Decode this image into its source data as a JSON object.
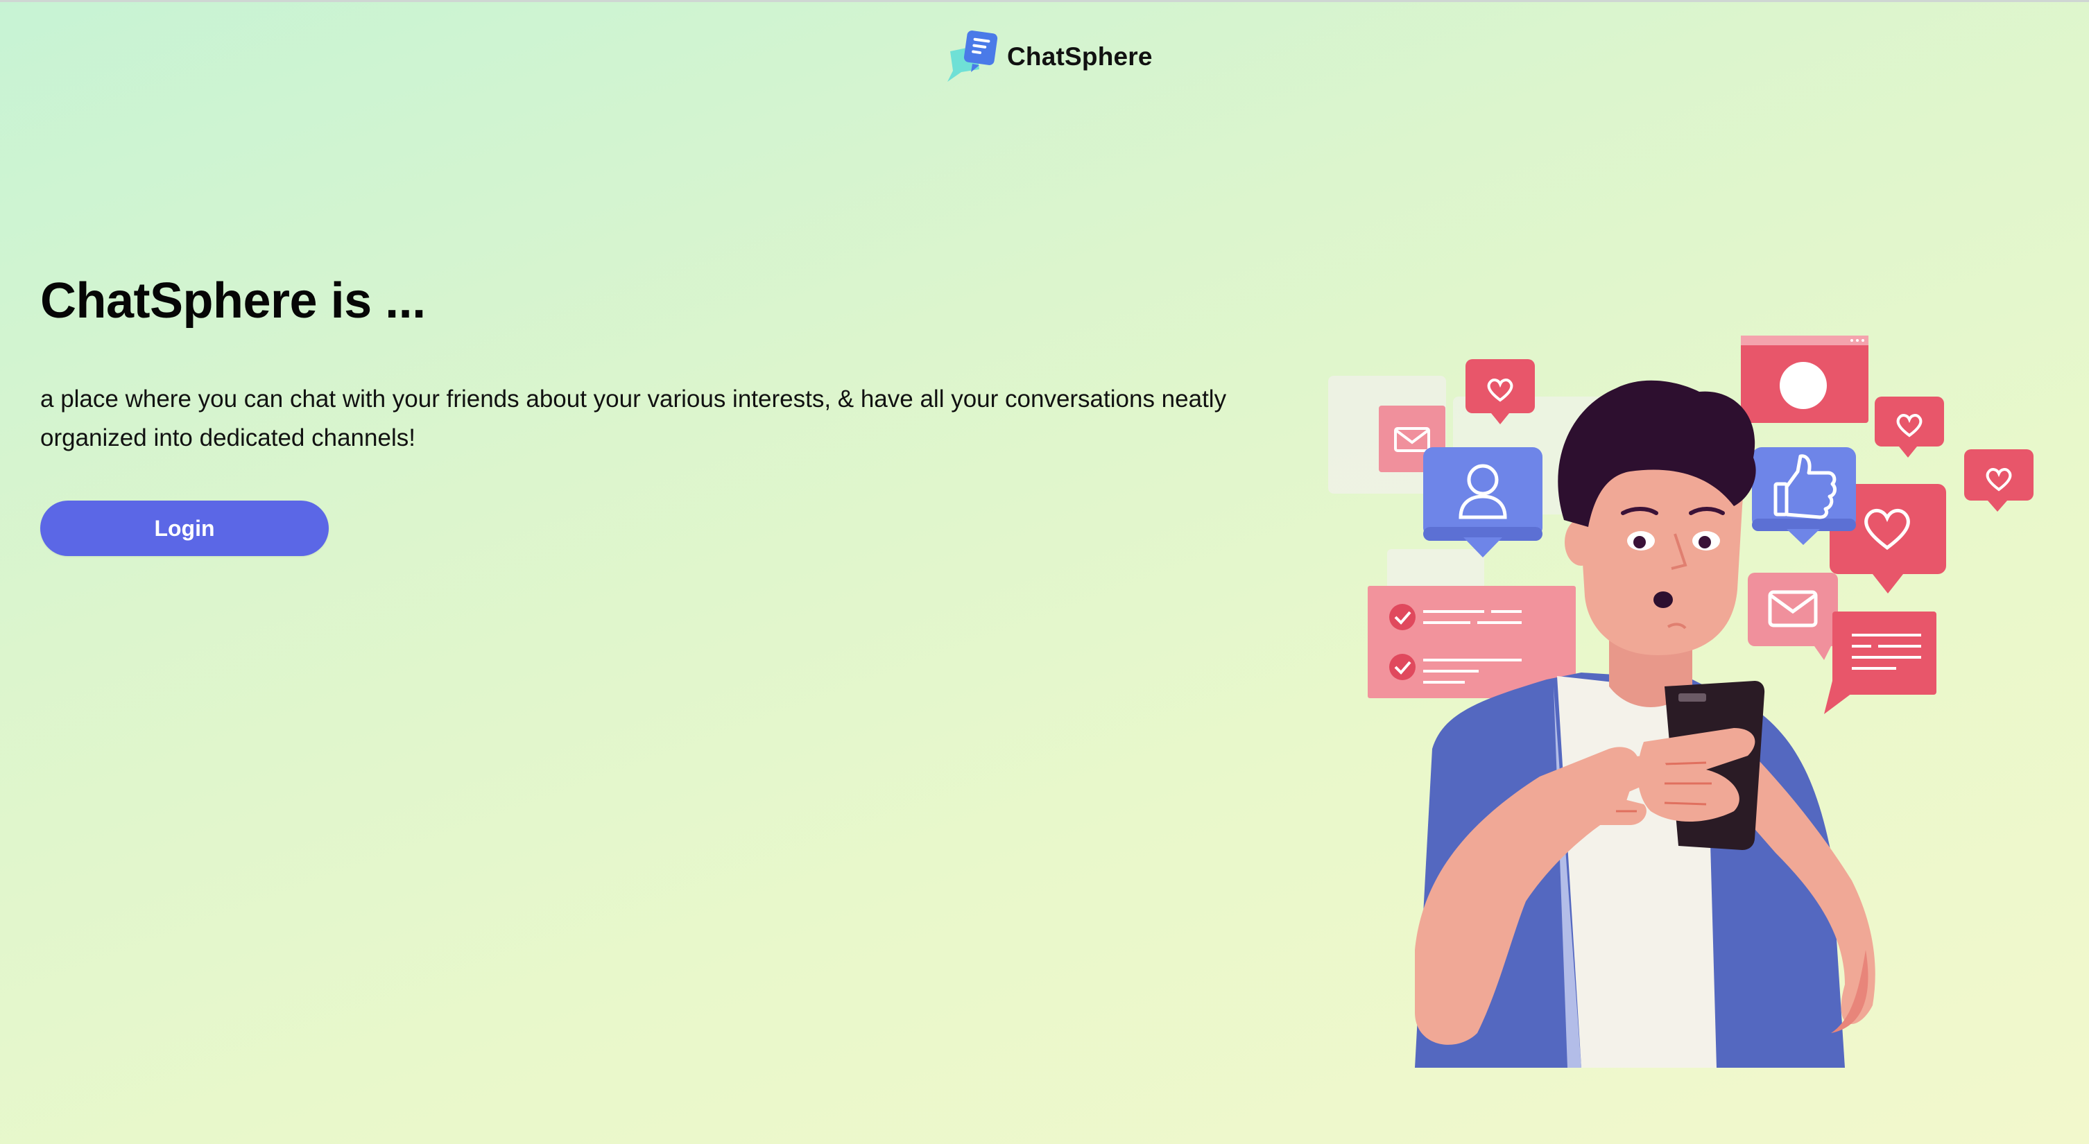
{
  "header": {
    "app_name": "ChatSphere",
    "logo_icon": "chat-bubbles-logo-icon"
  },
  "hero": {
    "title": "ChatSphere is ...",
    "description": "a place where you can chat with your friends about your various interests, & have all your conversations neatly organized into dedicated channels!",
    "login_label": "Login"
  },
  "illustration": {
    "subject": "person-using-phone-with-social-icons",
    "icons": [
      "heart-icon",
      "mail-icon",
      "user-icon",
      "thumbs-up-icon",
      "checklist-icon",
      "chat-bubble-icon"
    ]
  },
  "colors": {
    "accent": "#5b67e6",
    "background_start": "#c7f3d4",
    "background_end": "#f2f8cc",
    "notification_red": "#e8566a",
    "notification_blue": "#6e85e8",
    "shirt_blue": "#5468c0"
  }
}
